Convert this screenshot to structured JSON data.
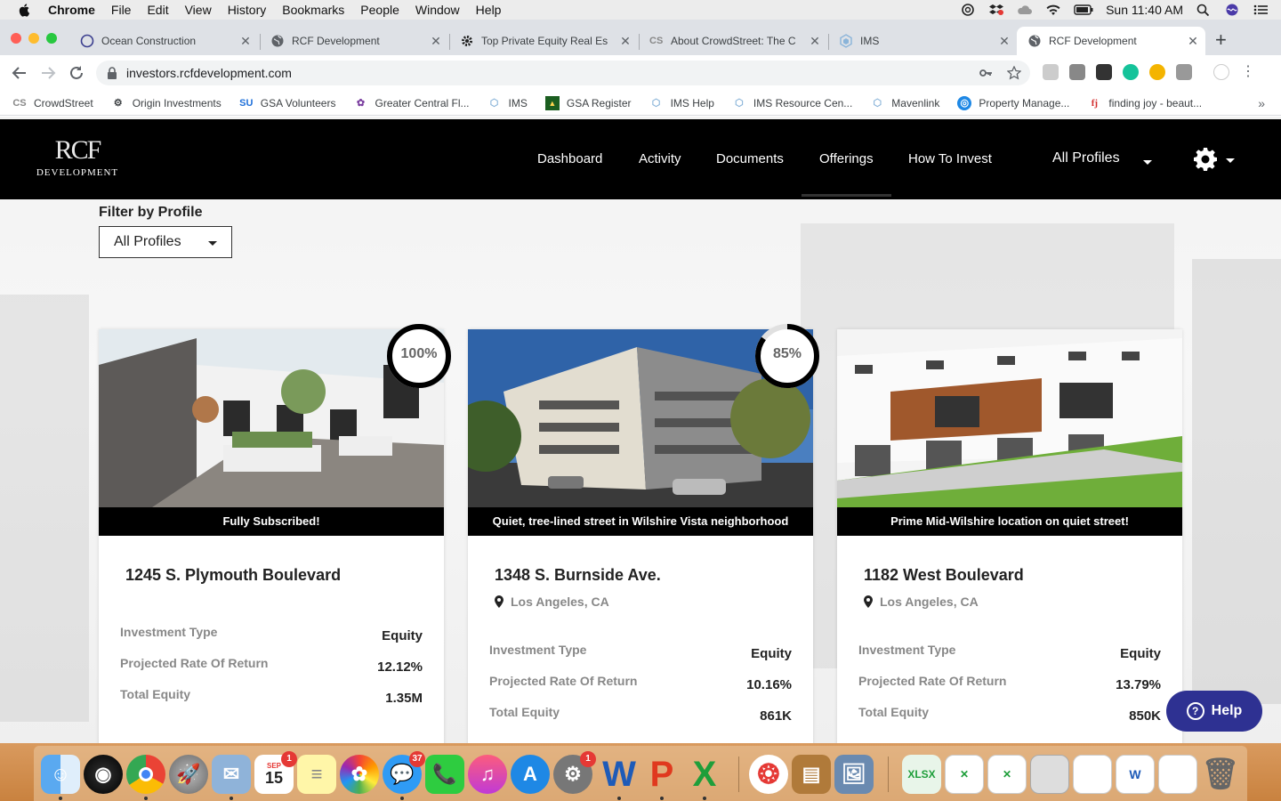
{
  "menubar": {
    "app": "Chrome",
    "items": [
      "File",
      "Edit",
      "View",
      "History",
      "Bookmarks",
      "People",
      "Window",
      "Help"
    ],
    "clock": "Sun 11:40 AM"
  },
  "tabs": [
    {
      "label": "Ocean Construction",
      "icon": "circle-icon"
    },
    {
      "label": "RCF Development",
      "icon": "globe-icon"
    },
    {
      "label": "Top Private Equity Real Es",
      "icon": "gear-icon"
    },
    {
      "label": "About CrowdStreet: The C",
      "icon": "cs-icon"
    },
    {
      "label": "IMS",
      "icon": "ims-icon"
    },
    {
      "label": "RCF Development",
      "icon": "globe-icon",
      "active": true
    }
  ],
  "address": {
    "url": "investors.rcfdevelopment.com"
  },
  "bookmarks": [
    {
      "label": "CrowdStreet",
      "icon": "CS"
    },
    {
      "label": "Origin Investments",
      "icon": "gear"
    },
    {
      "label": "GSA Volunteers",
      "icon": "SU"
    },
    {
      "label": "Greater Central Fl...",
      "icon": "flower"
    },
    {
      "label": "IMS",
      "icon": "ims"
    },
    {
      "label": "GSA Register",
      "icon": "gsa"
    },
    {
      "label": "IMS Help",
      "icon": "ims"
    },
    {
      "label": "IMS Resource Cen...",
      "icon": "ims"
    },
    {
      "label": "Mavenlink",
      "icon": "ims"
    },
    {
      "label": "Property Manage...",
      "icon": "compass"
    },
    {
      "label": "finding joy - beaut...",
      "icon": "fj"
    }
  ],
  "site": {
    "logo": {
      "mark": "RCF",
      "sub": "DEVELOPMENT"
    },
    "nav": [
      "Dashboard",
      "Activity",
      "Documents",
      "Offerings",
      "How To Invest"
    ],
    "profiles": "All Profiles"
  },
  "filter": {
    "label": "Filter by Profile",
    "value": "All Profiles"
  },
  "offerings": [
    {
      "caption": "Fully Subscribed!",
      "title": "1245 S. Plymouth Boulevard",
      "location": "",
      "progress": 1.0,
      "progress_label": "100%",
      "rows": [
        {
          "label": "Investment Type",
          "value": "Equity"
        },
        {
          "label": "Projected Rate Of Return",
          "value": "12.12%"
        },
        {
          "label": "Total Equity",
          "value": "1.35M"
        }
      ]
    },
    {
      "caption": "Quiet, tree-lined street in Wilshire Vista neighborhood",
      "title": "1348 S. Burnside Ave.",
      "location": "Los Angeles, CA",
      "progress": 0.85,
      "progress_label": "85%",
      "rows": [
        {
          "label": "Investment Type",
          "value": "Equity"
        },
        {
          "label": "Projected Rate Of Return",
          "value": "10.16%"
        },
        {
          "label": "Total Equity",
          "value": "861K"
        }
      ]
    },
    {
      "caption": "Prime Mid-Wilshire location on quiet street!",
      "title": "1182 West Boulevard",
      "location": "Los Angeles, CA",
      "progress": null,
      "rows": [
        {
          "label": "Investment Type",
          "value": "Equity"
        },
        {
          "label": "Projected Rate Of Return",
          "value": "13.79%"
        },
        {
          "label": "Total Equity",
          "value": "850K"
        }
      ]
    }
  ],
  "help": {
    "label": "Help"
  },
  "dock": {
    "calendar_month": "SEP",
    "calendar_day": "15",
    "badges": {
      "calendar": "1",
      "messages": "37",
      "system_prefs": "1"
    }
  }
}
